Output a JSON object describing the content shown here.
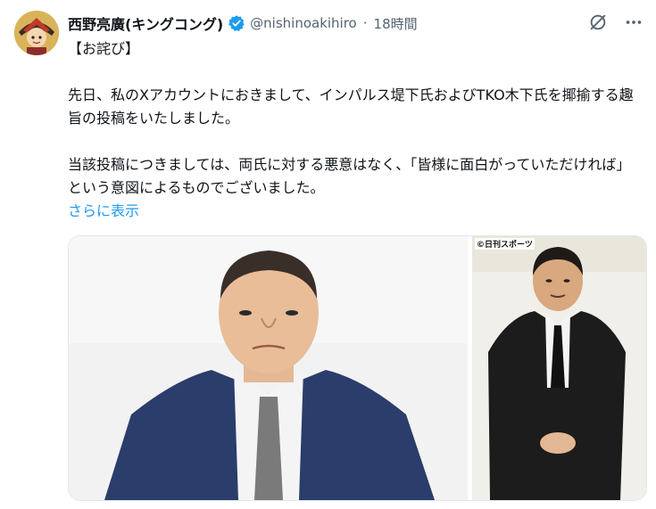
{
  "post": {
    "author_name": "西野亮廣(キングコング)",
    "handle": "@nishinoakihiro",
    "separator": "·",
    "time": "18時間",
    "text_lines": [
      "【お詫び】",
      "先日、私のXアカウントにおきまして、インパルス堤下氏およびTKO木下氏を揶揄する趣旨の投稿をいたしました。",
      "当該投稿につきましては、両氏に対する悪意はなく、「皆様に面白がっていただければ」という意図によるものでございました。"
    ],
    "show_more": "さらに表示"
  },
  "media": {
    "right_photo_credit": "©日刊スポーツ"
  },
  "icons": {
    "verified": "verified-badge-icon",
    "grok": "grok-icon",
    "more": "more-options-icon"
  },
  "colors": {
    "accent": "#1d9bf0",
    "secondary_text": "#536471"
  }
}
